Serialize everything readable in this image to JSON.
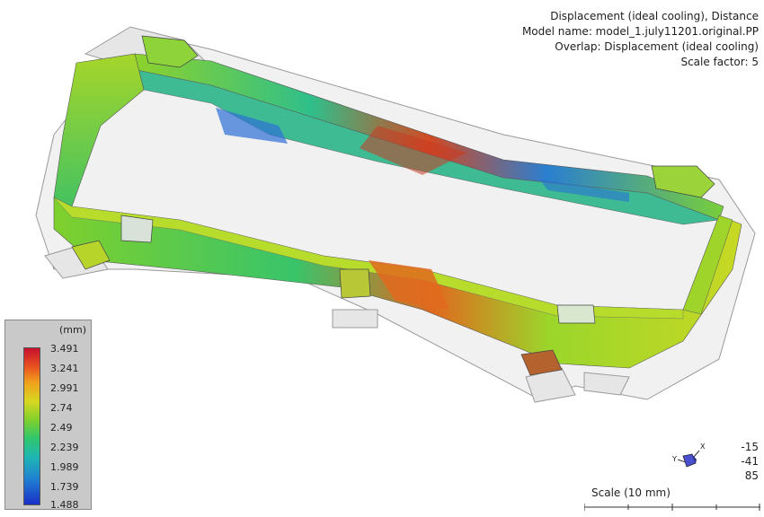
{
  "info": {
    "line1": "Displacement (ideal cooling), Distance",
    "line2": "Model name: model_1.july11201.original.PP",
    "line3": "Overlap: Displacement (ideal cooling)",
    "line4": "Scale factor: 5"
  },
  "legend": {
    "unit": "(mm)",
    "ticks": [
      "3.491",
      "3.241",
      "2.991",
      "2.74",
      "2.49",
      "2.239",
      "1.989",
      "1.739",
      "1.488"
    ]
  },
  "triad": {
    "axis_x_label": "X",
    "axis_y_label": "Y",
    "values": [
      "-15",
      "-41",
      "85"
    ]
  },
  "scale": {
    "label": "Scale (10 mm)"
  },
  "colors": {
    "max": "#c8102e",
    "min": "#1a2fc8",
    "mesh_shadow": "#b9b9b9"
  }
}
